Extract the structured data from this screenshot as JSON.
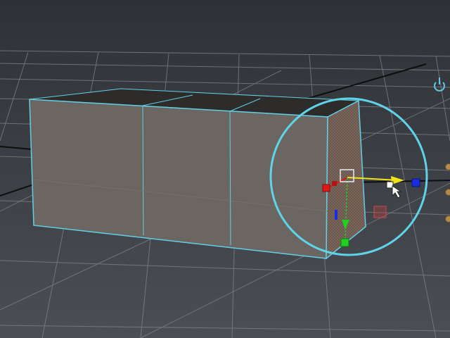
{
  "app": {
    "window_title": ""
  },
  "viewport": {
    "background_top": "#2f3238",
    "background_bottom": "#4a4e54",
    "grid_color": "#7d8288",
    "axis_color": "#111111",
    "selection_color": "#60cde6"
  },
  "object": {
    "name": "",
    "face_color": "#6b6662",
    "top_color": "#2e2d2c",
    "segments": 3
  },
  "manipulator": {
    "x_axis_color": "#e01818",
    "y_axis_color": "#1fd01f",
    "z_axis_color": "#1a2ee0",
    "active_axis_color": "#f2e21a",
    "soft_select_ring_color": "#5fd3ea"
  },
  "icons": {
    "camera_pivot": "power-like-icon",
    "cursor": "move-cursor-icon"
  },
  "side_controls": {
    "count": 3,
    "color": "#b38a4a"
  }
}
